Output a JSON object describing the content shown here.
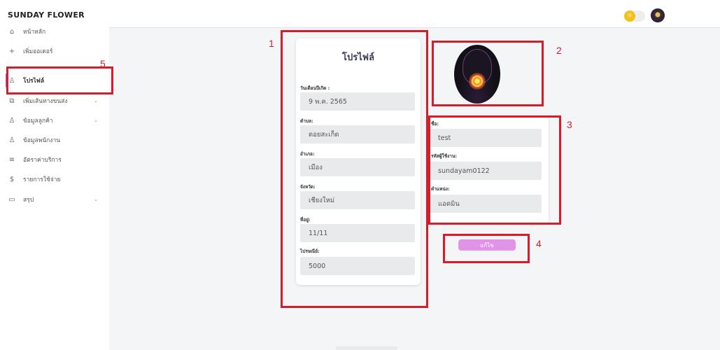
{
  "app": {
    "brand": "SUNDAY FLOWER"
  },
  "sidebar": {
    "items": [
      {
        "label": "หน้าหลัก",
        "icon": "home-icon",
        "glyph": "⌂",
        "chevron": false,
        "active": false
      },
      {
        "label": "เพิ่มออเดอร์",
        "icon": "plus-icon",
        "glyph": "+",
        "chevron": false,
        "active": false
      },
      {
        "label": "โปรไฟล์",
        "icon": "user-icon",
        "glyph": "♙",
        "chevron": false,
        "active": true
      },
      {
        "label": "เพิ่มเส้นทางขนส่ง",
        "icon": "route-icon",
        "glyph": "⧉",
        "chevron": true,
        "active": false
      },
      {
        "label": "ข้อมูลลูกค้า",
        "icon": "users-icon",
        "glyph": "♙",
        "chevron": true,
        "active": false
      },
      {
        "label": "ข้อมูลพนักงาน",
        "icon": "staff-icon",
        "glyph": "♙",
        "chevron": false,
        "active": false
      },
      {
        "label": "อัตราค่าบริการ",
        "icon": "rate-icon",
        "glyph": "≡",
        "chevron": false,
        "active": false
      },
      {
        "label": "รายการใช้จ่าย",
        "icon": "money-icon",
        "glyph": "$",
        "chevron": false,
        "active": false
      },
      {
        "label": "สรุป",
        "icon": "summary-icon",
        "glyph": "▭",
        "chevron": true,
        "active": false
      }
    ]
  },
  "profile": {
    "title": "โปรไฟล์",
    "fields": [
      {
        "label": "วันเดือนปีเกิด :",
        "value": "9 พ.ค. 2565"
      },
      {
        "label": "ตำบล:",
        "value": "ดอยสะเก็ด"
      },
      {
        "label": "อำเภอ:",
        "value": "เมือง"
      },
      {
        "label": "จังหวัด:",
        "value": "เชียงใหม่"
      },
      {
        "label": "ที่อยู่:",
        "value": "11/11"
      },
      {
        "label": "ไปรษณีย์:",
        "value": "5000"
      }
    ]
  },
  "info": {
    "fields": [
      {
        "label": "ชื่อ:",
        "value": "test"
      },
      {
        "label": "รหัสผู้ใช้งาน:",
        "value": "sundayam0122"
      },
      {
        "label": "ตำแหน่ง:",
        "value": "แอดมิน"
      }
    ]
  },
  "actions": {
    "edit_label": "แก้ไข"
  },
  "annotations": [
    "1",
    "2",
    "3",
    "4",
    "5"
  ],
  "colors": {
    "annotation": "#d71d2b",
    "accent": "#a060d8",
    "edit_button": "#e193e8",
    "toggle": "#f2c21b"
  }
}
